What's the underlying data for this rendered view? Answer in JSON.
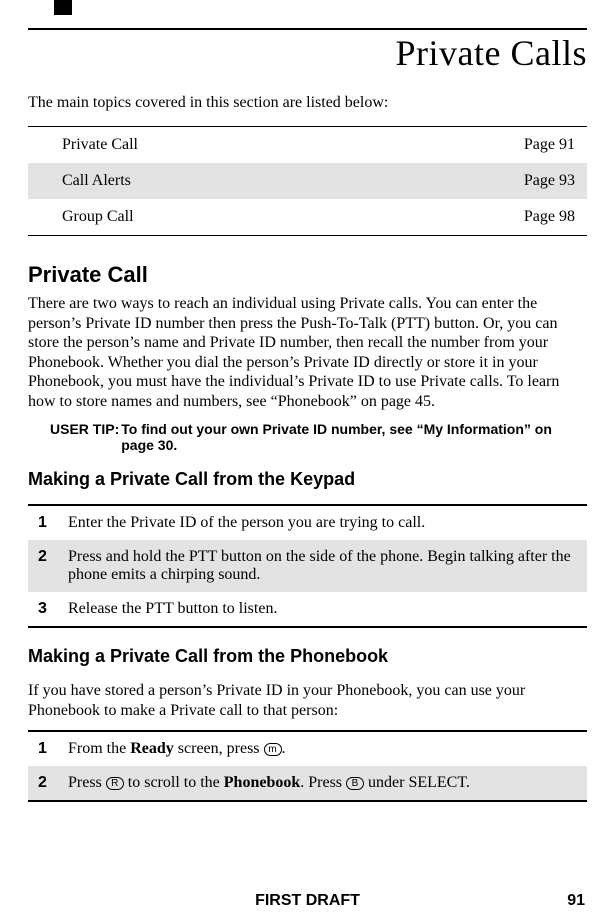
{
  "header": {
    "title": "Private Calls"
  },
  "intro": "The main topics covered in this section are listed below:",
  "topics": [
    {
      "label": "Private Call",
      "page": "Page 91",
      "alt": false
    },
    {
      "label": "Call Alerts",
      "page": "Page 93",
      "alt": true
    },
    {
      "label": "Group Call",
      "page": "Page 98",
      "alt": false
    }
  ],
  "section1": {
    "heading": "Private Call",
    "body": "There are two ways to reach an individual using Private calls. You can enter the person’s Private ID number then press the Push-To-Talk (PTT) button. Or, you can store the person’s name and Private ID number, then recall the number from your Phonebook. Whether you dial the person’s Private ID directly or store it in your Phonebook, you must have the individual’s Private ID to use Private calls. To learn how to store names and numbers, see “Phonebook” on page 45.",
    "tip_label": "USER TIP:",
    "tip_text": "To find out your own Private ID number, see “My Information” on page 30."
  },
  "section2": {
    "heading": "Making a Private Call from the Keypad",
    "steps": [
      {
        "n": "1",
        "text": "Enter the Private ID of the person you are trying to call.",
        "alt": false
      },
      {
        "n": "2",
        "text": "Press and hold the PTT button on the side of the phone. Begin talking after the phone emits a chirping sound.",
        "alt": true
      },
      {
        "n": "3",
        "text": "Release the PTT button to listen.",
        "alt": false
      }
    ]
  },
  "section3": {
    "heading": "Making a Private Call from the Phonebook",
    "intro": "If you have stored a person’s Private ID in your Phonebook, you can use your Phonebook to make a Private call to that person:",
    "steps": [
      {
        "n": "1",
        "prefix": "From the ",
        "bold1": "Ready",
        "mid1": " screen, press ",
        "icon1": "m",
        "suffix": ".",
        "alt": false
      },
      {
        "n": "2",
        "prefix": "Press ",
        "icon1": "R",
        "mid1": " to scroll to the ",
        "bold1": "Phonebook",
        "mid2": ". Press ",
        "icon2": "B",
        "suffix": " under SELECT.",
        "alt": true
      }
    ]
  },
  "footer": {
    "label": "FIRST DRAFT",
    "page": "91"
  }
}
